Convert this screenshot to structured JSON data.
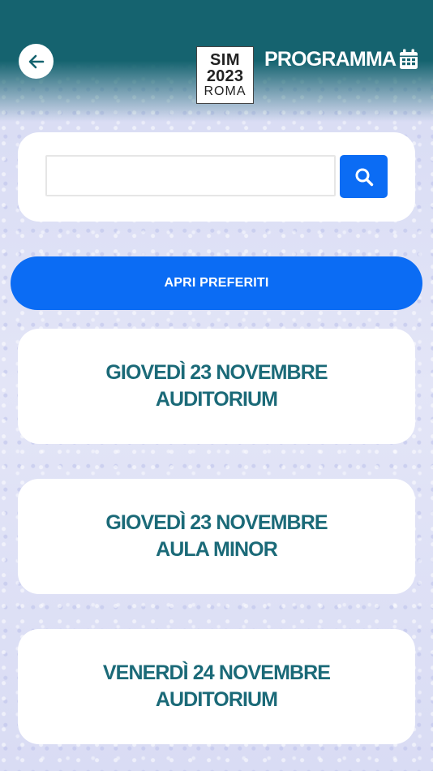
{
  "header": {
    "logo": {
      "line1": "SIM",
      "line2": "2023",
      "line3": "ROMA"
    },
    "title": "PROGRAMMA",
    "icons": {
      "back": "arrow-left-icon",
      "calendar": "calendar-icon",
      "search": "search-icon"
    }
  },
  "search": {
    "value": "",
    "placeholder": ""
  },
  "favorites_button": {
    "label": "APRI PREFERITI"
  },
  "days": [
    {
      "line1": "GIOVEDÌ 23 NOVEMBRE",
      "line2": "AUDITORIUM"
    },
    {
      "line1": "GIOVEDÌ 23 NOVEMBRE",
      "line2": "AULA MINOR"
    },
    {
      "line1": "VENERDÌ 24 NOVEMBRE",
      "line2": "AUDITORIUM"
    }
  ],
  "colors": {
    "header": "#15636f",
    "accent": "#0b6cf4",
    "card_text": "#1b6a78",
    "background": "#dcdff5"
  }
}
